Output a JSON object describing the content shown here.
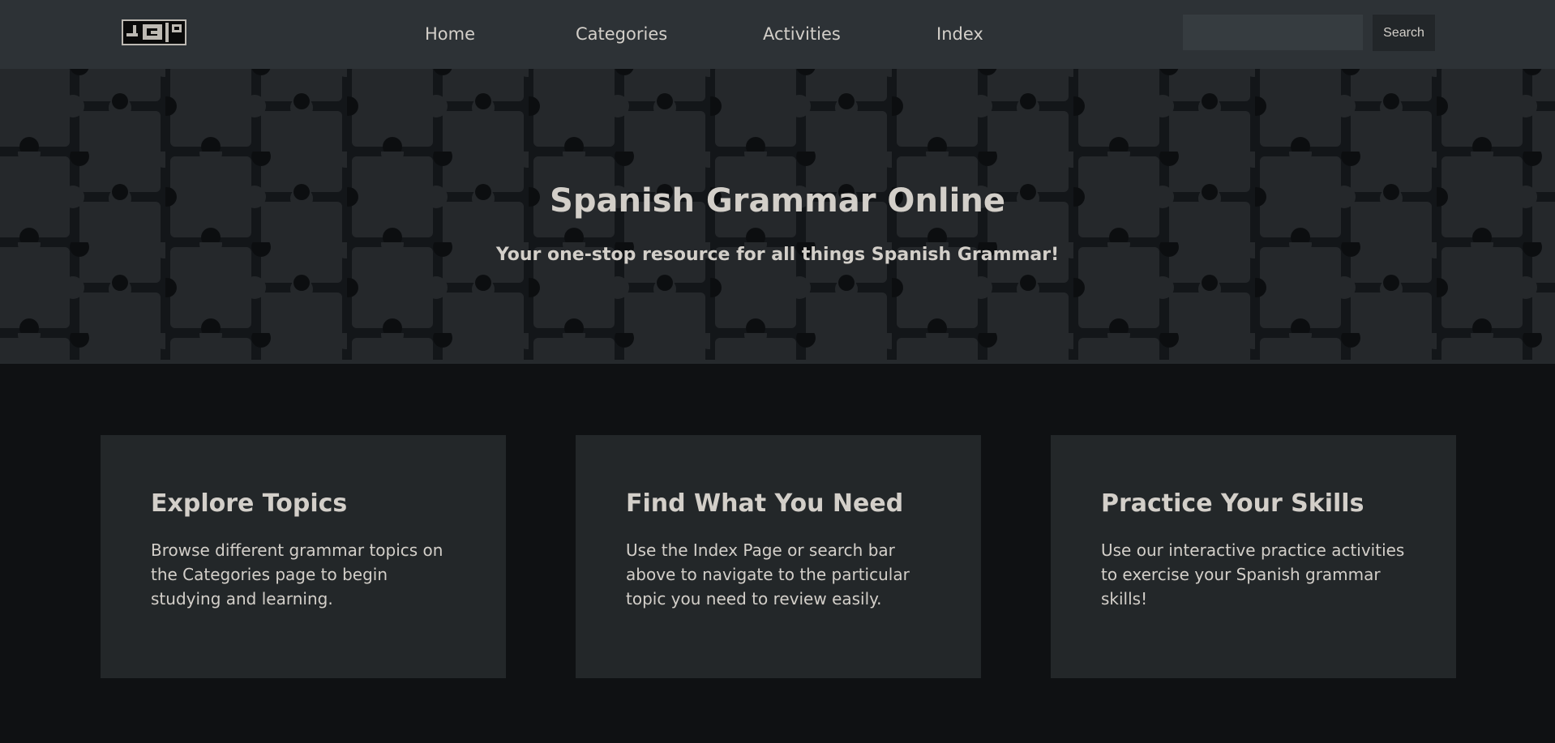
{
  "navbar": {
    "logo_alt": "SGO logo",
    "links": [
      {
        "label": "Home"
      },
      {
        "label": "Categories"
      },
      {
        "label": "Activities"
      },
      {
        "label": "Index"
      }
    ],
    "search": {
      "value": "",
      "placeholder": "",
      "button_label": "Search"
    }
  },
  "hero": {
    "title": "Spanish Grammar Online",
    "subtitle": "Your one-stop resource for all things Spanish Grammar!",
    "background": "dark jigsaw puzzle pattern"
  },
  "cards": [
    {
      "title": "Explore Topics",
      "text": "Browse different grammar topics on the Categories page to begin studying and learning."
    },
    {
      "title": "Find What You Need",
      "text": "Use the Index Page or search bar above to navigate to the particular topic you need to review easily."
    },
    {
      "title": "Practice Your Skills",
      "text": "Use our interactive practice activities to exercise your Spanish grammar skills!"
    }
  ],
  "colors": {
    "navbar_bg": "#2d3236",
    "page_bg": "#0f1113",
    "card_bg": "#232729",
    "text": "#d3cfc9",
    "search_button_bg": "#222629",
    "search_input_bg": "#363c40"
  }
}
